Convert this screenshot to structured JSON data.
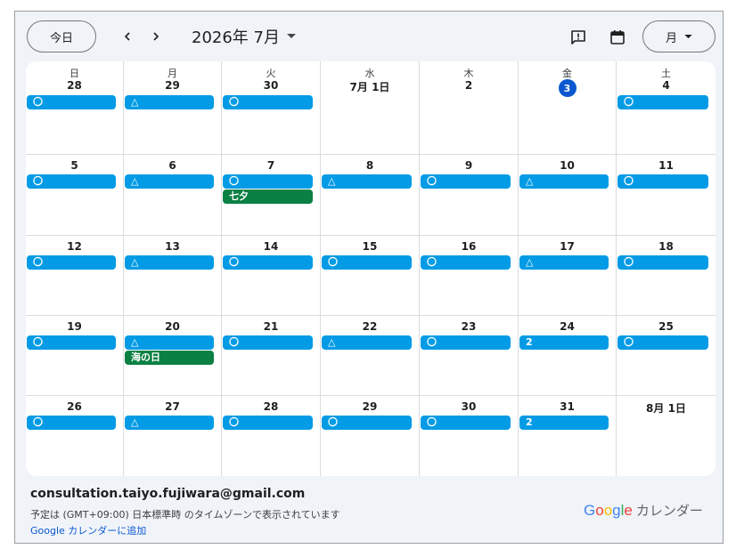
{
  "toolbar": {
    "today_label": "今日",
    "month_label": "2026年 7月",
    "view_label": "月"
  },
  "weekdays": [
    "日",
    "月",
    "火",
    "水",
    "木",
    "金",
    "土"
  ],
  "weeks": [
    [
      {
        "date": "28",
        "events": [
          {
            "label": "〇"
          }
        ]
      },
      {
        "date": "29",
        "events": [
          {
            "label": "△"
          }
        ]
      },
      {
        "date": "30",
        "events": [
          {
            "label": "〇"
          }
        ]
      },
      {
        "date": "7月 1日",
        "events": []
      },
      {
        "date": "2",
        "events": []
      },
      {
        "date": "3",
        "today": true,
        "events": []
      },
      {
        "date": "4",
        "events": [
          {
            "label": "〇"
          }
        ]
      }
    ],
    [
      {
        "date": "5",
        "events": [
          {
            "label": "〇"
          }
        ]
      },
      {
        "date": "6",
        "events": [
          {
            "label": "△"
          }
        ]
      },
      {
        "date": "7",
        "events": [
          {
            "label": "〇"
          },
          {
            "label": "七夕",
            "holiday": true
          }
        ]
      },
      {
        "date": "8",
        "events": [
          {
            "label": "△"
          }
        ]
      },
      {
        "date": "9",
        "events": [
          {
            "label": "〇"
          }
        ]
      },
      {
        "date": "10",
        "events": [
          {
            "label": "△"
          }
        ]
      },
      {
        "date": "11",
        "events": [
          {
            "label": "〇"
          }
        ]
      }
    ],
    [
      {
        "date": "12",
        "events": [
          {
            "label": "〇"
          }
        ]
      },
      {
        "date": "13",
        "events": [
          {
            "label": "△"
          }
        ]
      },
      {
        "date": "14",
        "events": [
          {
            "label": "〇"
          }
        ]
      },
      {
        "date": "15",
        "events": [
          {
            "label": "〇"
          }
        ]
      },
      {
        "date": "16",
        "events": [
          {
            "label": "〇"
          }
        ]
      },
      {
        "date": "17",
        "events": [
          {
            "label": "△"
          }
        ]
      },
      {
        "date": "18",
        "events": [
          {
            "label": "〇"
          }
        ]
      }
    ],
    [
      {
        "date": "19",
        "events": [
          {
            "label": "〇"
          }
        ]
      },
      {
        "date": "20",
        "events": [
          {
            "label": "△"
          },
          {
            "label": "海の日",
            "holiday": true
          }
        ]
      },
      {
        "date": "21",
        "events": [
          {
            "label": "〇"
          }
        ]
      },
      {
        "date": "22",
        "events": [
          {
            "label": "△"
          }
        ]
      },
      {
        "date": "23",
        "events": [
          {
            "label": "〇"
          }
        ]
      },
      {
        "date": "24",
        "events": [
          {
            "label": "2"
          }
        ]
      },
      {
        "date": "25",
        "events": [
          {
            "label": "〇"
          }
        ]
      }
    ],
    [
      {
        "date": "26",
        "events": [
          {
            "label": "〇"
          }
        ]
      },
      {
        "date": "27",
        "events": [
          {
            "label": "△"
          }
        ]
      },
      {
        "date": "28",
        "events": [
          {
            "label": "〇"
          }
        ]
      },
      {
        "date": "29",
        "events": [
          {
            "label": "〇"
          }
        ]
      },
      {
        "date": "30",
        "events": [
          {
            "label": "〇"
          }
        ]
      },
      {
        "date": "31",
        "events": [
          {
            "label": "2"
          }
        ]
      },
      {
        "date": "8月 1日",
        "events": []
      }
    ]
  ],
  "footer": {
    "email": "consultation.taiyo.fujiwara@gmail.com",
    "timezone_note": "予定は (GMT+09:00) 日本標準時 のタイムゾーンで表示されています",
    "add_link": "Google カレンダーに追加",
    "brand_google": [
      "G",
      "o",
      "o",
      "g",
      "l",
      "e"
    ],
    "brand_calendar": "カレンダー"
  },
  "colors": {
    "event": "#039be5",
    "holiday": "#0b8043",
    "today": "#0b57d0",
    "background": "#f0f4f9"
  },
  "icons": {
    "prev": "chevron-left-icon",
    "next": "chevron-right-icon",
    "feedback": "feedback-icon",
    "calendar": "calendar-icon",
    "dropdown": "caret-down-icon"
  }
}
